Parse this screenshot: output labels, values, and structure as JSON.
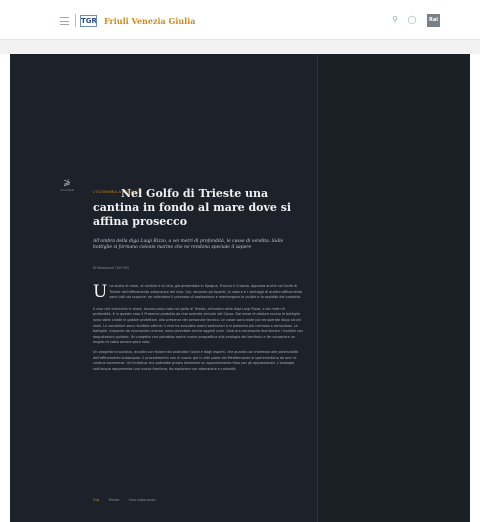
{
  "header": {
    "logo_text": "TGR",
    "region": "Friuli Venezia Giulia",
    "search_icon": "search-icon",
    "user_icon": "user-icon",
    "brand_badge": "Rai"
  },
  "article": {
    "share_label": "Condividi",
    "tag": "L'ECONOMIA A NORD-EST",
    "title": "Nel Golfo di Trieste una cantina in fondo al mare dove si affina prosecco",
    "subtitle": "All'ombra della diga Luigi Rizzo, a sei metri di profondità, le casse di vendita. Sulle bottiglie si formano colonie marine che ne rendono speciale il sapore",
    "author": "Di Redazione TGR FVG",
    "dropcap": "U",
    "paragraphs": [
      "na storia di mare, di cantine e di vino, già presentata in Spagna, Francia e Croazia. Approda anche nel Golfo di Trieste dell'affinamento subacqueo del vino. Qui, secondo gli esperti, la natura e i vantaggi di questo affinamento sono tutti da scoprire: ne rallentano il processo di ossidazione e mantengono la pulizia e la sapidità del prodotto.",
      "Il vino che invecchia in mare, ancora poco noto nel golfo di Trieste, all'ombra della diga Luigi Rizzo, a sei metri di profondità, è in questo caso il Prosecco prodotto da due aziende vinicole del Carso. Dal mese di ottobre scorso le bottiglie sono state calate in gabbie protettive, alla presenza del personale tecnico. Le casse sono state poi recuperate dopo alcuni mesi. Le condizioni sono risultate ottime: il vino ha acquisito aromi particolari e si presenta più cremoso e armonioso. Le bottiglie, ricoperte da concrezioni marine, sono diventate anche oggetti unici. Sarà ora necessario monitorare i risultati con degustazioni guidate. Un progetto che potrebbe aprire nuove prospettive alla enologia del territorio e far conoscere un angolo di costa ancora poco noto.",
      "Un progetto innovativo, accolto con favore dai produttori locali e dagli esperti, che guarda con interesse alle potenzialità dell'affinamento subacqueo. Il procedimento non è nuovo: già in altri paesi del Mediterraneo si sperimentano da anni le cantine sommerse. Un'iniziativa che potrebbe presto diventare un appuntamento fisso per gli appassionati. L'enologia sott'acqua rappresenta una nuova frontiera, da esplorare con attenzione e curiosità."
    ],
    "tags": [
      "Fvg",
      "Trieste",
      "Vino subacqueo"
    ]
  }
}
